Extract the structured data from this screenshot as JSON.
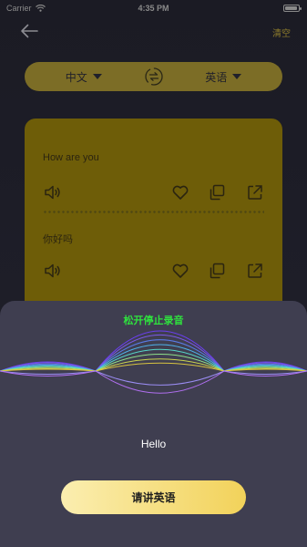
{
  "status_bar": {
    "carrier": "Carrier",
    "time": "4:35 PM"
  },
  "nav": {
    "clear_label": "清空"
  },
  "language_bar": {
    "source": "中文",
    "target": "英语"
  },
  "translation_card": {
    "source_text": "How are you",
    "translated_text": "你好吗"
  },
  "voice_overlay": {
    "hint": "松开停止录音",
    "recognized_text": "Hello",
    "speak_button": "请讲英语"
  },
  "colors": {
    "accent": "#f2d25a",
    "card": "#6e5d08",
    "hint": "#2fe23e",
    "overlay": "#3f3e50"
  },
  "icons": [
    "back-arrow-icon",
    "wifi-icon",
    "battery-icon",
    "chevron-down-icon",
    "swap-icon",
    "speaker-icon",
    "heart-icon",
    "copy-icon",
    "share-icon",
    "waveform-icon"
  ]
}
